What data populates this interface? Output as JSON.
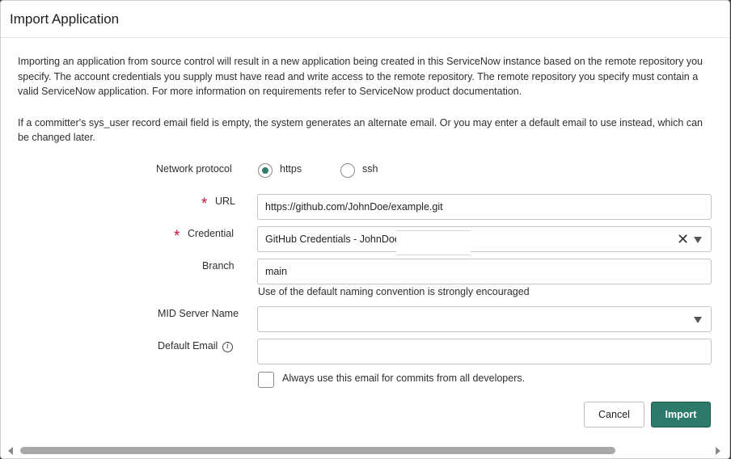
{
  "dialog": {
    "title": "Import Application",
    "intro_p1": "Importing an application from source control will result in a new application being created in this ServiceNow instance based on the remote repository you specify. The account credentials you supply must have read and write access to the remote repository. The remote repository you specify must contain a valid ServiceNow application. For more information on requirements refer to ServiceNow product documentation.",
    "intro_p2": "If a committer's sys_user record email field is empty, the system generates an alternate email. Or you may enter a default email to use instead, which can be changed later."
  },
  "form": {
    "network_protocol": {
      "label": "Network protocol",
      "options": [
        "https",
        "ssh"
      ],
      "selected": "https"
    },
    "url": {
      "label": "URL",
      "value": "https://github.com/JohnDoe/example.git"
    },
    "credential": {
      "label": "Credential",
      "value": "GitHub Credentials - JohnDoe/"
    },
    "branch": {
      "label": "Branch",
      "value": "main",
      "hint": "Use of the default naming convention is strongly encouraged"
    },
    "mid_server": {
      "label": "MID Server Name",
      "value": ""
    },
    "default_email": {
      "label": "Default Email",
      "value": ""
    },
    "always_use_email": {
      "label": "Always use this email for commits from all developers.",
      "checked": false
    }
  },
  "buttons": {
    "cancel": "Cancel",
    "import": "Import"
  },
  "colors": {
    "primary": "#2b7a6a",
    "required": "#c8102e"
  }
}
